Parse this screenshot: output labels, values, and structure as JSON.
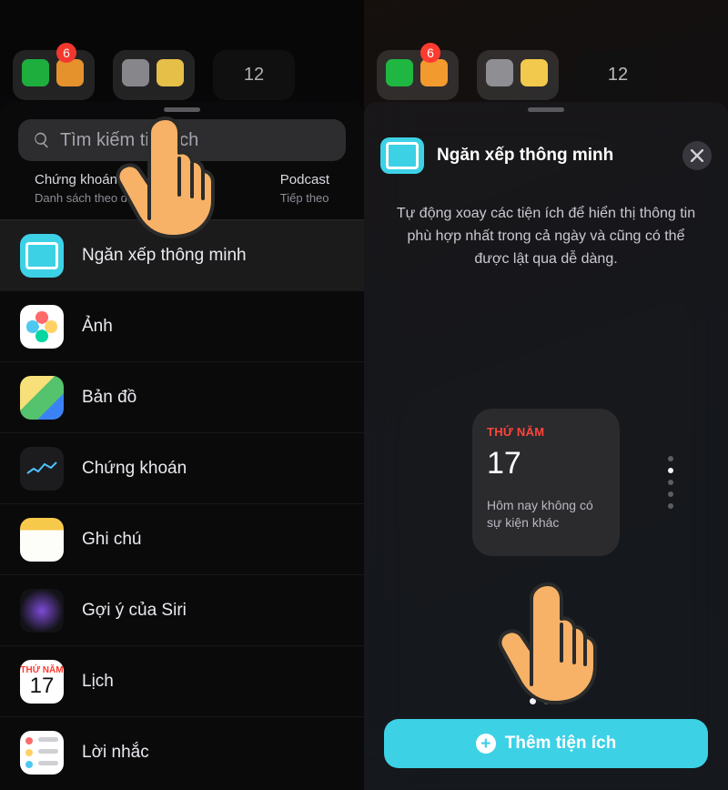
{
  "home": {
    "badge": "6",
    "clock": "12"
  },
  "leftSheet": {
    "searchPlaceholder": "Tìm kiếm tiện ích",
    "chips": [
      {
        "title": "Chứng khoán",
        "subtitle": "Danh sách theo dõi"
      },
      {
        "title": "Podcast",
        "subtitle": "Tiếp theo"
      }
    ],
    "rows": {
      "smartStack": "Ngăn xếp thông minh",
      "photos": "Ảnh",
      "maps": "Bản đồ",
      "stocks": "Chứng khoán",
      "notes": "Ghi chú",
      "siri": "Gợi ý của Siri",
      "calendar": "Lịch",
      "reminders": "Lời nhắc"
    },
    "calendarIcon": {
      "weekday": "THỨ NĂM",
      "day": "17"
    }
  },
  "rightSheet": {
    "title": "Ngăn xếp thông minh",
    "subtitle": "Tự động xoay các tiện ích để hiển thị thông tin phù hợp nhất trong cả ngày và cũng có thể được lật qua dễ dàng.",
    "widget": {
      "weekday": "THỨ NĂM",
      "day": "17",
      "message": "Hôm nay không có sự kiện khác"
    },
    "addButton": "Thêm tiện ích"
  }
}
